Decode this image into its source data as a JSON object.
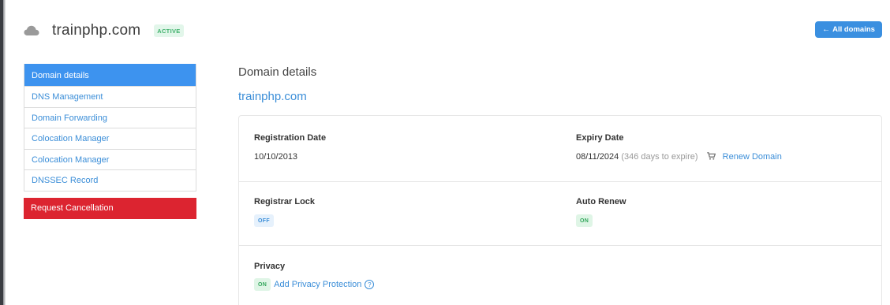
{
  "header": {
    "title": "trainphp.com",
    "status": "ACTIVE",
    "all_domains_label": "All domains",
    "icon": "cloud-icon"
  },
  "sidebar": {
    "items": [
      {
        "label": "Domain details",
        "active": true
      },
      {
        "label": "DNS Management"
      },
      {
        "label": "Domain Forwarding"
      },
      {
        "label": "Colocation Manager"
      },
      {
        "label": "Colocation Manager"
      },
      {
        "label": "DNSSEC Record"
      }
    ],
    "cancel_label": "Request Cancellation"
  },
  "main": {
    "title": "Domain details",
    "domain_link": "trainphp.com",
    "registration": {
      "label": "Registration Date",
      "value": "10/10/2013"
    },
    "expiry": {
      "label": "Expiry Date",
      "value": "08/11/2024",
      "remaining": "(346 days to expire)",
      "renew_label": "Renew Domain"
    },
    "registrar_lock": {
      "label": "Registrar Lock",
      "state": "OFF"
    },
    "auto_renew": {
      "label": "Auto Renew",
      "state": "ON"
    },
    "privacy": {
      "label": "Privacy",
      "state": "ON",
      "action_label": "Add Privacy Protection",
      "help": "?"
    }
  },
  "colors": {
    "primary": "#3d93ef",
    "link": "#3b8ed8",
    "danger": "#dc2430",
    "success": "#3fb06b"
  }
}
